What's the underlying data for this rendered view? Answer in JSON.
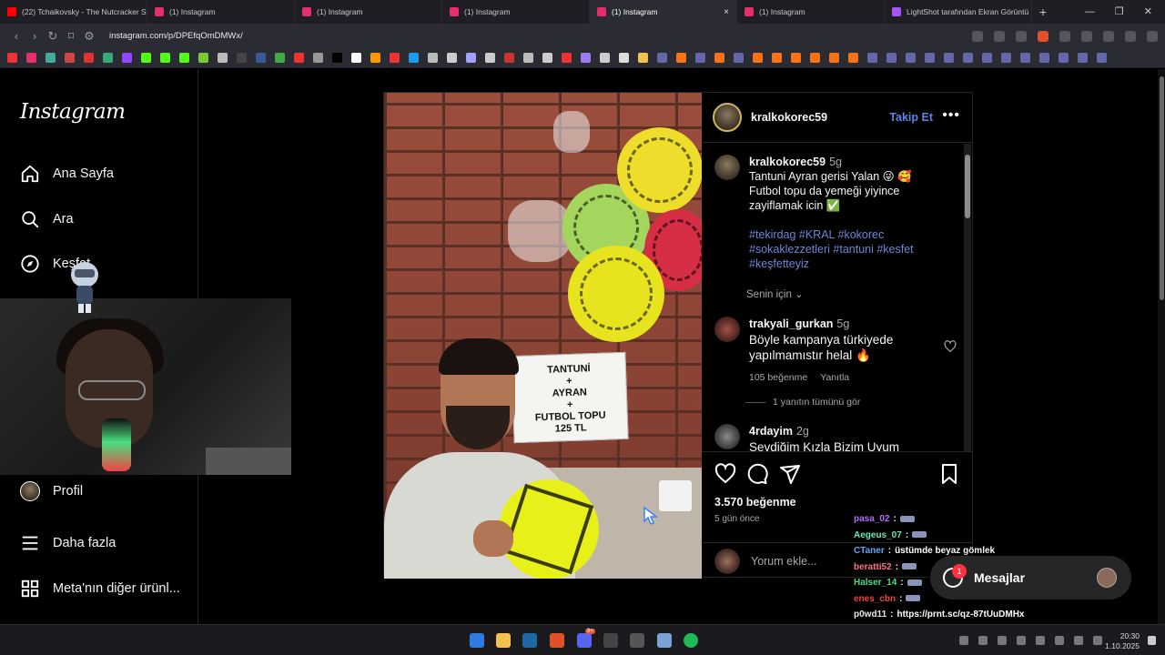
{
  "browser": {
    "tabs": [
      {
        "label": "(22) Tchaikovsky - The Nutcracker Su",
        "color": "#ff0000",
        "active": false
      },
      {
        "label": "(1) Instagram",
        "color": "#e1306c",
        "active": false
      },
      {
        "label": "(1) Instagram",
        "color": "#e1306c",
        "active": false
      },
      {
        "label": "(1) Instagram",
        "color": "#e1306c",
        "active": false
      },
      {
        "label": "(1) Instagram",
        "color": "#e1306c",
        "active": true
      },
      {
        "label": "(1) Instagram",
        "color": "#e1306c",
        "active": false
      },
      {
        "label": "LightShot tarafından Ekran Görüntü",
        "color": "#a855f7",
        "active": false
      }
    ],
    "tab_close": "×",
    "new_tab": "+",
    "url": "instagram.com/p/DPEfqOmDMWx/",
    "brave_badge": "10"
  },
  "sidebar": {
    "logo": "Instagram",
    "items": [
      {
        "label": "Ana Sayfa",
        "icon": "home-icon"
      },
      {
        "label": "Ara",
        "icon": "search-icon"
      },
      {
        "label": "Keşfet",
        "icon": "compass-icon"
      },
      {
        "label": "Profil",
        "icon": "avatar"
      },
      {
        "label": "Daha fazla",
        "icon": "menu-icon"
      },
      {
        "label": "Meta'nın diğer ürünl...",
        "icon": "grid-icon"
      }
    ]
  },
  "post": {
    "photo_sign": [
      "TANTUNİ",
      "+",
      "AYRAN",
      "+",
      "FUTBOL TOPU",
      "125 TL"
    ],
    "author": "kralkokorec59",
    "follow_label": "Takip Et",
    "caption": {
      "user": "kralkokorec59",
      "time": "5g",
      "line1": "Tantuni Ayran gerisi Yalan 😜 🥰",
      "line2": "Futbol topu da yemeği yiyince",
      "line3": "zayiflamak icin ✅",
      "tags1": "#tekirdag #KRAL #kokorec",
      "tags2": "#sokaklezzetleri #tantuni #kesfet",
      "tags3": "#keşfetteyiz"
    },
    "for_you": "Senin için",
    "comments": [
      {
        "user": "trakyali_gurkan",
        "time": "5g",
        "line1": "Böyle kampanya türkiyede",
        "line2": "yapılmamıstır helal 🔥",
        "likes": "105 beğenme",
        "reply": "Yanıtla"
      },
      {
        "user": "4rdayim",
        "time": "2g",
        "line1": "Sevdiğim Kızla Bizim Uyum"
      }
    ],
    "view_replies": "1 yanıtın tümünü gör",
    "likes": "3.570 beğenme",
    "posted": "5 gün önce",
    "add_comment_placeholder": "Yorum ekle..."
  },
  "chat": [
    {
      "user": "pasa_02",
      "color": "#b36bff",
      "msg": ""
    },
    {
      "user": "Aegeus_07",
      "color": "#6ee7b7",
      "msg": ""
    },
    {
      "user": "CTaner",
      "color": "#60a5fa",
      "msg": "üstümde beyaz gömlek"
    },
    {
      "user": "beratti52",
      "color": "#fb7185",
      "msg": ""
    },
    {
      "user": "Halser_14",
      "color": "#4ade80",
      "msg": ""
    },
    {
      "user": "enes_cbn",
      "color": "#ef4444",
      "msg": ""
    },
    {
      "user": "p0wd11",
      "color": "#e5e7eb",
      "msg": "https://prnt.sc/qz-87tUuDMHx"
    }
  ],
  "chat_sep": ":",
  "messages": {
    "label": "Mesajlar",
    "badge": "1"
  },
  "taskbar": {
    "time": "20:30",
    "date": "1.10.2025",
    "discord_badge": "9+"
  }
}
